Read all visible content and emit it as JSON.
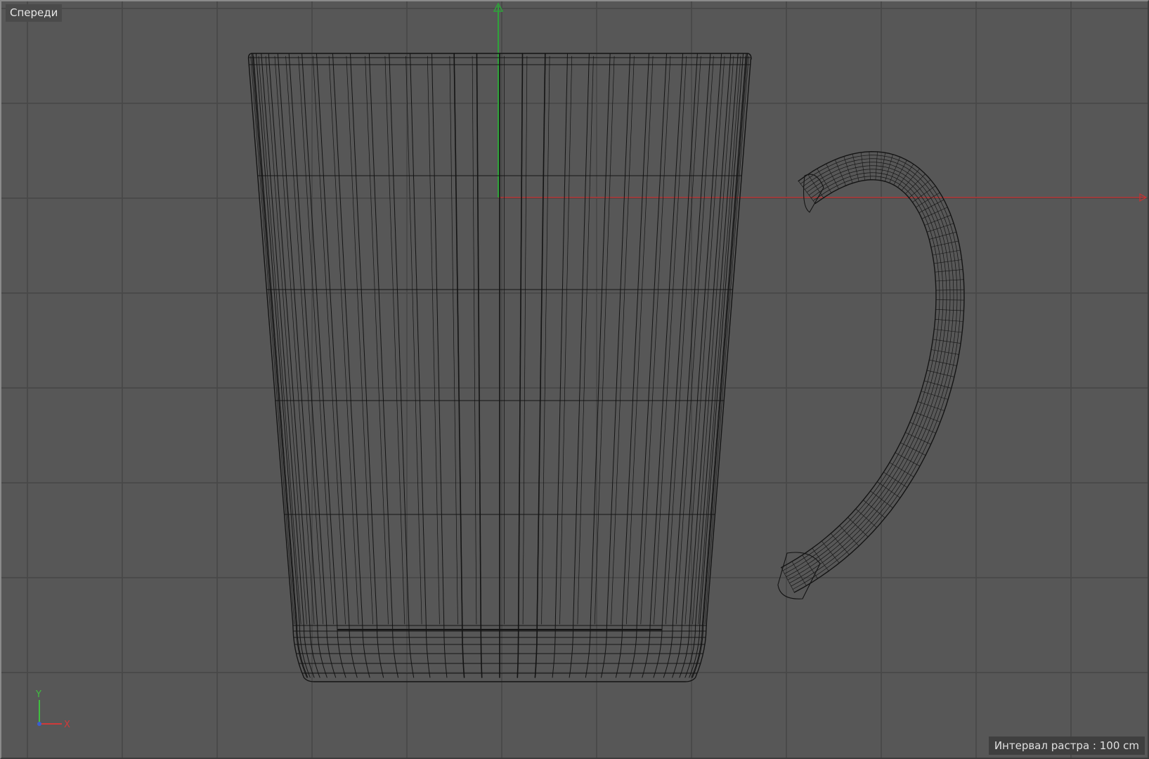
{
  "viewport": {
    "view_name": "Спереди",
    "grid_interval_text": "Интервал растра : 100 cm"
  },
  "gizmo": {
    "y_label": "Y",
    "x_label": "X"
  },
  "colors": {
    "background": "#575757",
    "grid_line": "#474747",
    "wire": "#141414",
    "axis_x": "#c83232",
    "axis_y": "#2fa23a",
    "gizmo_y": "#3fbf3f",
    "gizmo_x": "#d03a3a",
    "gizmo_z": "#3a5fd0"
  },
  "scene": {
    "object": "mug-wireframe",
    "view_axis_icons": [
      "y-axis-arrow-icon",
      "x-axis-arrow-icon"
    ]
  }
}
